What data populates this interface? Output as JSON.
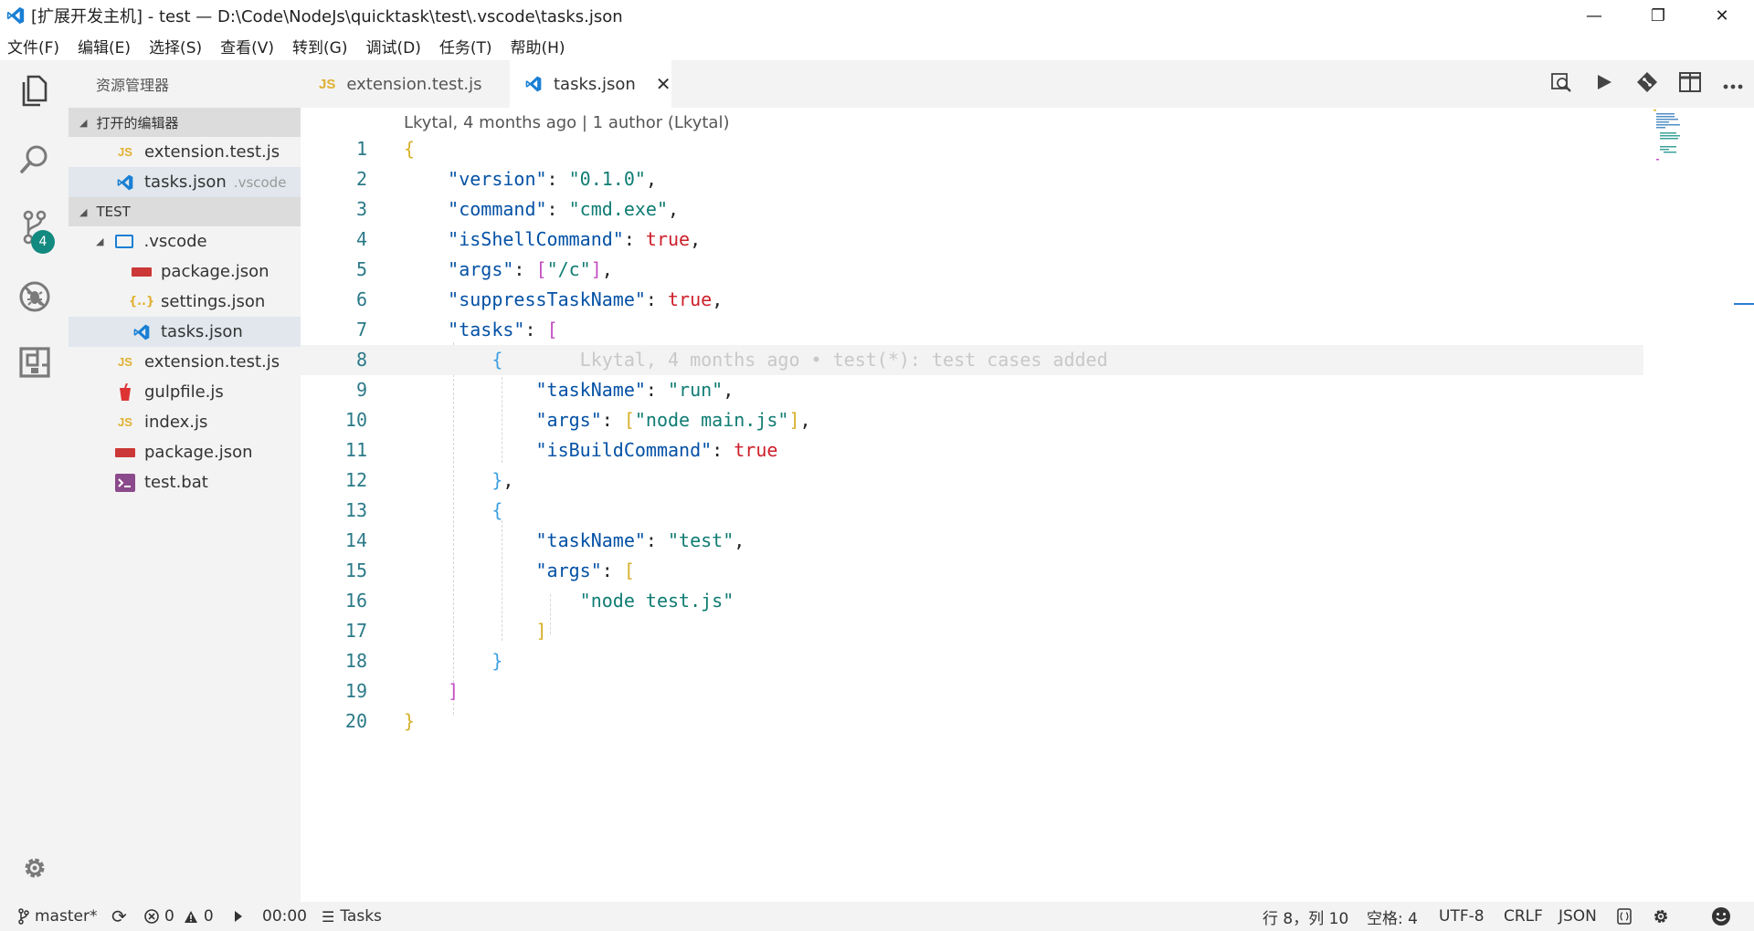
{
  "window": {
    "title": "[扩展开发主机] - test — D:\\Code\\NodeJs\\quicktask\\test\\.vscode\\tasks.json",
    "minimize": "—",
    "restore": "❐",
    "close": "✕"
  },
  "menu": [
    "文件(F)",
    "编辑(E)",
    "选择(S)",
    "查看(V)",
    "转到(G)",
    "调试(D)",
    "任务(T)",
    "帮助(H)"
  ],
  "activity": {
    "scm_badge": "4"
  },
  "sidebar": {
    "title": "资源管理器",
    "open_editors_header": "打开的编辑器",
    "open_editors": [
      {
        "name": "extension.test.js",
        "desc": ""
      },
      {
        "name": "tasks.json",
        "desc": ".vscode"
      }
    ],
    "folder_header": "TEST",
    "tree": [
      {
        "name": ".vscode"
      },
      {
        "name": "package.json"
      },
      {
        "name": "settings.json"
      },
      {
        "name": "tasks.json"
      },
      {
        "name": "extension.test.js"
      },
      {
        "name": "gulpfile.js"
      },
      {
        "name": "index.js"
      },
      {
        "name": "package.json"
      },
      {
        "name": "test.bat"
      }
    ]
  },
  "tabs": [
    {
      "label": "extension.test.js",
      "icon_text": "JS"
    },
    {
      "label": "tasks.json",
      "close": "✕"
    }
  ],
  "editor": {
    "codelens": "Lkytal, 4 months ago | 1 author (Lkytal)",
    "blame": "Lkytal, 4 months ago • test(*): test cases added",
    "line_numbers": [
      "1",
      "2",
      "3",
      "4",
      "5",
      "6",
      "7",
      "8",
      "9",
      "10",
      "11",
      "12",
      "13",
      "14",
      "15",
      "16",
      "17",
      "18",
      "19",
      "20"
    ],
    "lines": {
      "l1_b": "{",
      "l2_k": "\"version\"",
      "l2_v": "\"0.1.0\"",
      "l3_k": "\"command\"",
      "l3_v": "\"cmd.exe\"",
      "l4_k": "\"isShellCommand\"",
      "l4_v": "true",
      "l5_k": "\"args\"",
      "l5_v": "\"/c\"",
      "l6_k": "\"suppressTaskName\"",
      "l6_v": "true",
      "l7_k": "\"tasks\"",
      "l9_k": "\"taskName\"",
      "l9_v": "\"run\"",
      "l10_k": "\"args\"",
      "l10_v": "\"node main.js\"",
      "l11_k": "\"isBuildCommand\"",
      "l11_v": "true",
      "l14_k": "\"taskName\"",
      "l14_v": "\"test\"",
      "l15_k": "\"args\"",
      "l16_v": "\"node test.js\""
    }
  },
  "statusbar": {
    "branch": "master*",
    "errors": "0",
    "warnings": "0",
    "time": "00:00",
    "tasks": "Tasks",
    "position": "行 8，列 10",
    "spaces": "空格: 4",
    "encoding": "UTF-8",
    "eol": "CRLF",
    "language": "JSON"
  },
  "colors": {
    "accent": "#1a7fd4",
    "badge": "#138a80",
    "json_key": "#0451a5",
    "json_string": "#0f7c73",
    "json_literal": "#cd1f2a"
  }
}
